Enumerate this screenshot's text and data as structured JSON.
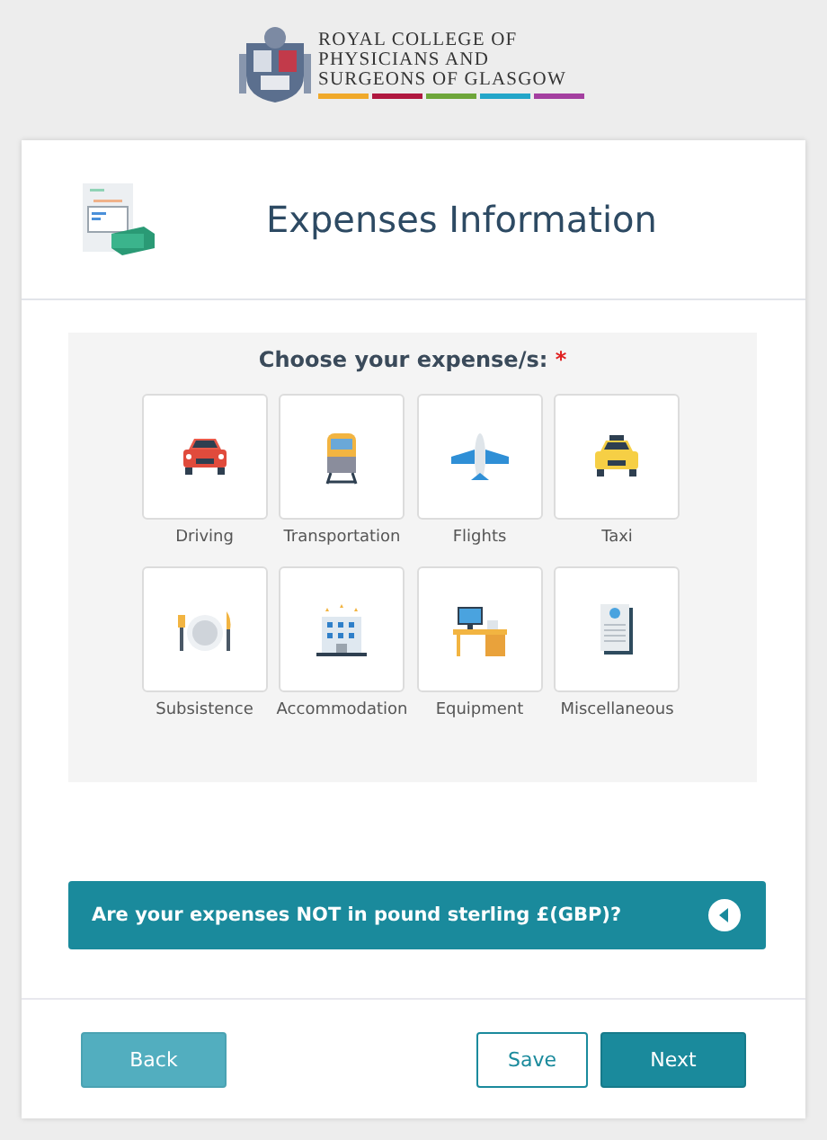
{
  "logo": {
    "lines": [
      "ROYAL COLLEGE OF",
      "PHYSICIANS AND",
      "SURGEONS OF GLASGOW"
    ]
  },
  "header": {
    "title": "Expenses Information"
  },
  "chooser": {
    "prompt": "Choose your expense/s:",
    "required_mark": "*",
    "options": [
      {
        "label": "Driving",
        "kind": "car",
        "selected": false
      },
      {
        "label": "Transportation",
        "kind": "train",
        "selected": false
      },
      {
        "label": "Flights",
        "kind": "plane",
        "selected": false
      },
      {
        "label": "Taxi",
        "kind": "taxi",
        "selected": false
      },
      {
        "label": "Subsistence",
        "kind": "cutlery",
        "selected": false
      },
      {
        "label": "Accommodation",
        "kind": "hotel",
        "selected": false
      },
      {
        "label": "Equipment",
        "kind": "desk",
        "selected": false
      },
      {
        "label": "Miscellaneous",
        "kind": "receipt",
        "selected": false
      }
    ]
  },
  "currency_panel": {
    "question": "Are your expenses NOT in pound sterling £(GBP)?",
    "expanded": false
  },
  "buttons": [
    {
      "label": "Back",
      "kind": "muted"
    },
    {
      "label": "Save",
      "kind": "outline"
    },
    {
      "label": "Next",
      "kind": "primary"
    }
  ]
}
